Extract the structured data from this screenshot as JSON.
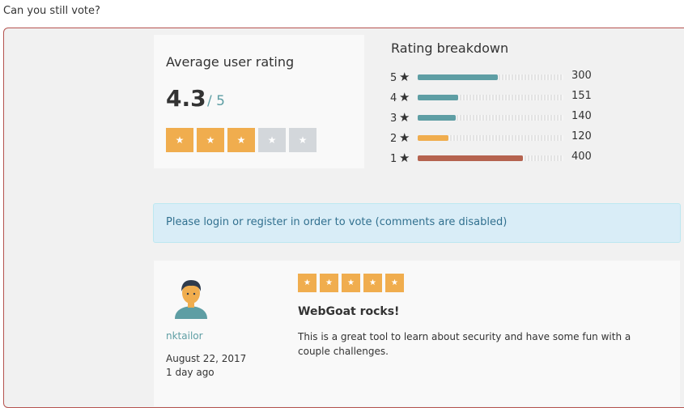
{
  "page": {
    "question": "Can you still vote?"
  },
  "rating": {
    "title": "Average user rating",
    "value": "4.3",
    "out_of": "/ 5",
    "stars": [
      {
        "symbol": "★",
        "filled": true
      },
      {
        "symbol": "★",
        "filled": true
      },
      {
        "symbol": "★",
        "filled": true
      },
      {
        "symbol": "★",
        "filled": false
      },
      {
        "symbol": "★",
        "filled": false
      }
    ]
  },
  "breakdown": {
    "title": "Rating breakdown",
    "star_symbol": "★",
    "rows": [
      {
        "stars": "5",
        "count": "300",
        "percent": 55,
        "color": "#5e9ea4"
      },
      {
        "stars": "4",
        "count": "151",
        "percent": 28,
        "color": "#5e9ea4"
      },
      {
        "stars": "3",
        "count": "140",
        "percent": 26,
        "color": "#5e9ea4"
      },
      {
        "stars": "2",
        "count": "120",
        "percent": 21,
        "color": "#f0ad4e"
      },
      {
        "stars": "1",
        "count": "400",
        "percent": 72,
        "color": "#b5634f"
      }
    ]
  },
  "alert": {
    "text": "Please login or register in order to vote (comments are disabled)"
  },
  "comment": {
    "username": "nktailor",
    "date": "August 22, 2017",
    "ago": "1 day ago",
    "rating_stars": 5,
    "star_symbol": "★",
    "title": "WebGoat rocks!",
    "body": "This is a great tool to learn about security and have some fun with a couple challenges."
  },
  "colors": {
    "accent": "#f0ad4e",
    "teal": "#5e9ea4",
    "panel_border": "#b5534f",
    "alert_bg": "#d9edf7",
    "alert_text": "#31708f"
  }
}
